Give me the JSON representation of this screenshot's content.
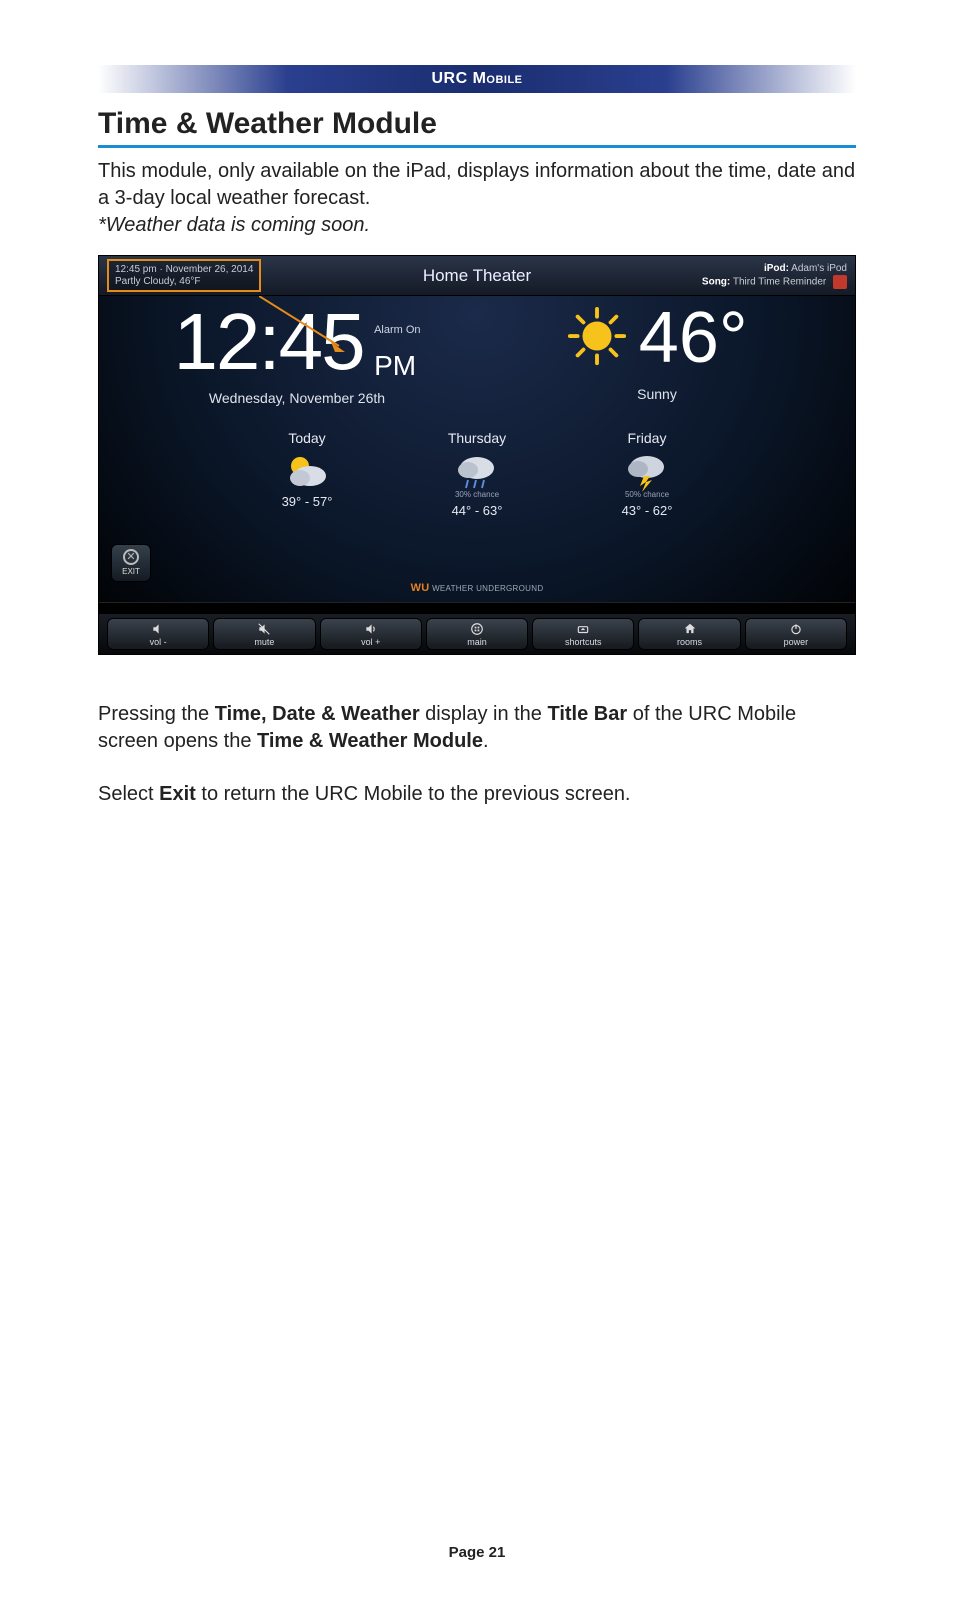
{
  "header": {
    "product": "URC Mobile"
  },
  "section": {
    "title": "Time & Weather Module",
    "intro": "This module, only available on the iPad, displays information about the time, date and a 3-day local weather forecast.",
    "note": "*Weather data is coming soon."
  },
  "screenshot": {
    "titlebar": {
      "time_date": "12:45 pm · November 26, 2014",
      "weather_summary": "Partly Cloudy, 46°F",
      "room": "Home Theater",
      "ipod_label": "iPod:",
      "ipod_value": "Adam's iPod",
      "song_label": "Song:",
      "song_value": "Third Time Reminder"
    },
    "clock": {
      "time": "12:45",
      "alarm": "Alarm On",
      "ampm": "PM",
      "date": "Wednesday, November 26th"
    },
    "current": {
      "temp": "46°",
      "condition": "Sunny"
    },
    "forecast": [
      {
        "day": "Today",
        "chance": "",
        "range": "39° - 57°",
        "icon": "partly-cloudy"
      },
      {
        "day": "Thursday",
        "chance": "30% chance",
        "range": "44° - 63°",
        "icon": "rain"
      },
      {
        "day": "Friday",
        "chance": "50% chance",
        "range": "43° - 62°",
        "icon": "storm"
      }
    ],
    "exit_label": "EXIT",
    "credit_brand": "WU",
    "credit_text": "WEATHER UNDERGROUND",
    "toolbar": {
      "vol_down": "vol -",
      "mute": "mute",
      "vol_up": "vol +",
      "main": "main",
      "shortcuts": "shortcuts",
      "rooms": "rooms",
      "power": "power"
    }
  },
  "body": {
    "p1_a": "Pressing the ",
    "p1_b": "Time, Date & Weather",
    "p1_c": " display in the ",
    "p1_d": "Title Bar",
    "p1_e": " of the URC Mobile screen opens the ",
    "p1_f": "Time & Weather Module",
    "p1_g": ".",
    "p2_a": "Select ",
    "p2_b": "Exit",
    "p2_c": " to return the URC Mobile to the previous screen."
  },
  "footer": {
    "page": "Page 21"
  }
}
